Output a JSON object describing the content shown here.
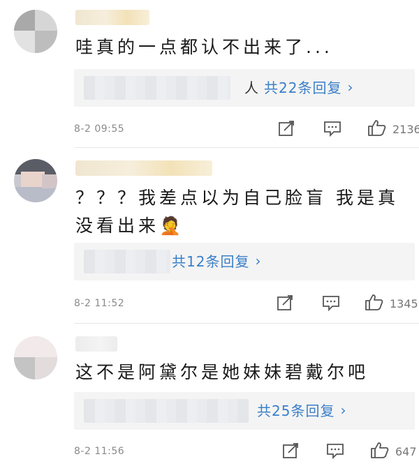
{
  "comments": [
    {
      "text": "哇真的一点都认不出来了...",
      "reply_count": "共22条回复",
      "reply_prefix_visible": "人",
      "time": "8-2 09:55",
      "likes": "2136"
    },
    {
      "text": "？？？我差点以为自己脸盲 我是真没看出来🤦",
      "reply_count": "共12条回复",
      "time": "8-2 11:52",
      "likes": "1345"
    },
    {
      "text": "这不是阿黛尔是她妹妹碧戴尔吧",
      "reply_count": "共25条回复",
      "time": "8-2 11:56",
      "likes": "647"
    }
  ],
  "icons": {
    "share": "share-icon",
    "comment": "comment-icon",
    "like": "thumbs-up-icon",
    "chevron": "chevron-right-icon"
  },
  "colors": {
    "link_blue": "#3a7fc8",
    "meta_gray": "#8a8a8a",
    "reply_bg": "#f4f4f4"
  }
}
